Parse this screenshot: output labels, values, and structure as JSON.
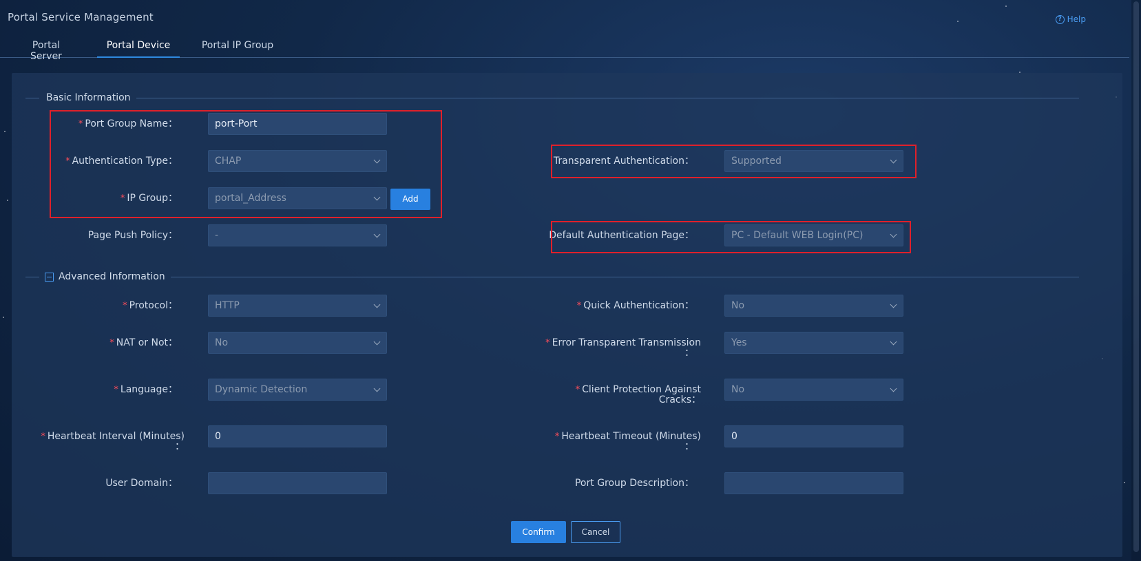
{
  "header": {
    "title": "Portal Service Management",
    "help_label": "Help"
  },
  "tabs": [
    {
      "label": "Portal Server"
    },
    {
      "label": "Portal Device"
    },
    {
      "label": "Portal IP Group"
    }
  ],
  "basic": {
    "section_title": "Basic Information",
    "port_group_name": {
      "label": "Port Group Name：",
      "value": "port-Port"
    },
    "auth_type": {
      "label": "Authentication Type：",
      "value": "CHAP"
    },
    "ip_group": {
      "label": "IP Group：",
      "value": "portal_Address",
      "add_label": "Add"
    },
    "page_push_policy": {
      "label": "Page Push Policy：",
      "value": "-"
    },
    "transparent_auth": {
      "label": "Transparent Authentication：",
      "value": "Supported"
    },
    "default_auth_page": {
      "label": "Default Authentication Page：",
      "value": "PC - Default WEB Login(PC)"
    }
  },
  "advanced": {
    "section_title": "Advanced Information",
    "protocol": {
      "label": "Protocol：",
      "value": "HTTP"
    },
    "nat": {
      "label": "NAT or Not：",
      "value": "No"
    },
    "language": {
      "label": "Language：",
      "value": "Dynamic Detection"
    },
    "heartbeat_interval": {
      "label_1": "Heartbeat Interval (Minutes)",
      "label_2": "：",
      "value": "0"
    },
    "user_domain": {
      "label": "User Domain：",
      "value": ""
    },
    "quick_auth": {
      "label": "Quick Authentication：",
      "value": "No"
    },
    "error_transparent": {
      "label_1": "Error Transparent Transmission",
      "label_2": "：",
      "value": "Yes"
    },
    "client_protection": {
      "label_1": "Client Protection Against",
      "label_2": "Cracks：",
      "value": "No"
    },
    "heartbeat_timeout": {
      "label_1": "Heartbeat Timeout (Minutes)",
      "label_2": "：",
      "value": "0"
    },
    "port_group_desc": {
      "label": "Port Group Description：",
      "value": ""
    }
  },
  "actions": {
    "confirm_label": "Confirm",
    "cancel_label": "Cancel"
  },
  "required_mark": "*",
  "colors": {
    "accent": "#2880e0",
    "required": "#ff4d5a",
    "highlight_box": "#e0202a"
  }
}
